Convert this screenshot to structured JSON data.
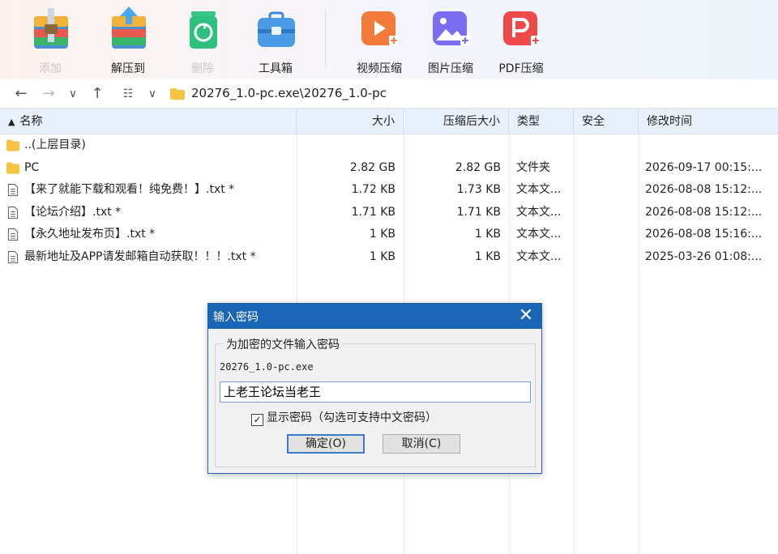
{
  "toolbar": {
    "add": "添加",
    "extract": "解压到",
    "delete": "删除",
    "tools": "工具箱",
    "video": "视频压缩",
    "image": "图片压缩",
    "pdf": "PDF压缩"
  },
  "address": {
    "path": "20276_1.0-pc.exe\\20276_1.0-pc"
  },
  "columns": {
    "name": "名称",
    "size": "大小",
    "packed": "压缩后大小",
    "type": "类型",
    "security": "安全",
    "modified": "修改时间"
  },
  "files": [
    {
      "name": "..(上层目录)",
      "size": "",
      "packed": "",
      "type": "",
      "modified": "",
      "icon": "folder-icon"
    },
    {
      "name": "PC",
      "size": "2.82 GB",
      "packed": "2.82 GB",
      "type": "文件夹",
      "modified": "2026-09-17 00:15:...",
      "icon": "folder-icon"
    },
    {
      "name": "【来了就能下载和观看！纯免费！】.txt *",
      "size": "1.72 KB",
      "packed": "1.73 KB",
      "type": "文本文...",
      "modified": "2026-08-08 15:12:...",
      "icon": "text-file-icon"
    },
    {
      "name": "【论坛介绍】.txt *",
      "size": "1.71 KB",
      "packed": "1.71 KB",
      "type": "文本文...",
      "modified": "2026-08-08 15:12:...",
      "icon": "text-file-icon"
    },
    {
      "name": "【永久地址发布页】.txt *",
      "size": "1 KB",
      "packed": "1 KB",
      "type": "文本文...",
      "modified": "2026-08-08 15:16:...",
      "icon": "text-file-icon"
    },
    {
      "name": "最新地址及APP请发邮箱自动获取！！！.txt *",
      "size": "1 KB",
      "packed": "1 KB",
      "type": "文本文...",
      "modified": "2025-03-26 01:08:...",
      "icon": "text-file-icon"
    }
  ],
  "dialog": {
    "title": "输入密码",
    "group_label": "为加密的文件输入密码",
    "filename": "20276_1.0-pc.exe",
    "password": "上老王论坛当老王",
    "show_password_label": "显示密码（勾选可支持中文密码）",
    "show_password_checked": "✓",
    "ok_label": "确定(O)",
    "cancel_label": "取消(C)"
  },
  "colors": {
    "accent": "#1a65b6",
    "header_bg": "#e8f1fb"
  }
}
